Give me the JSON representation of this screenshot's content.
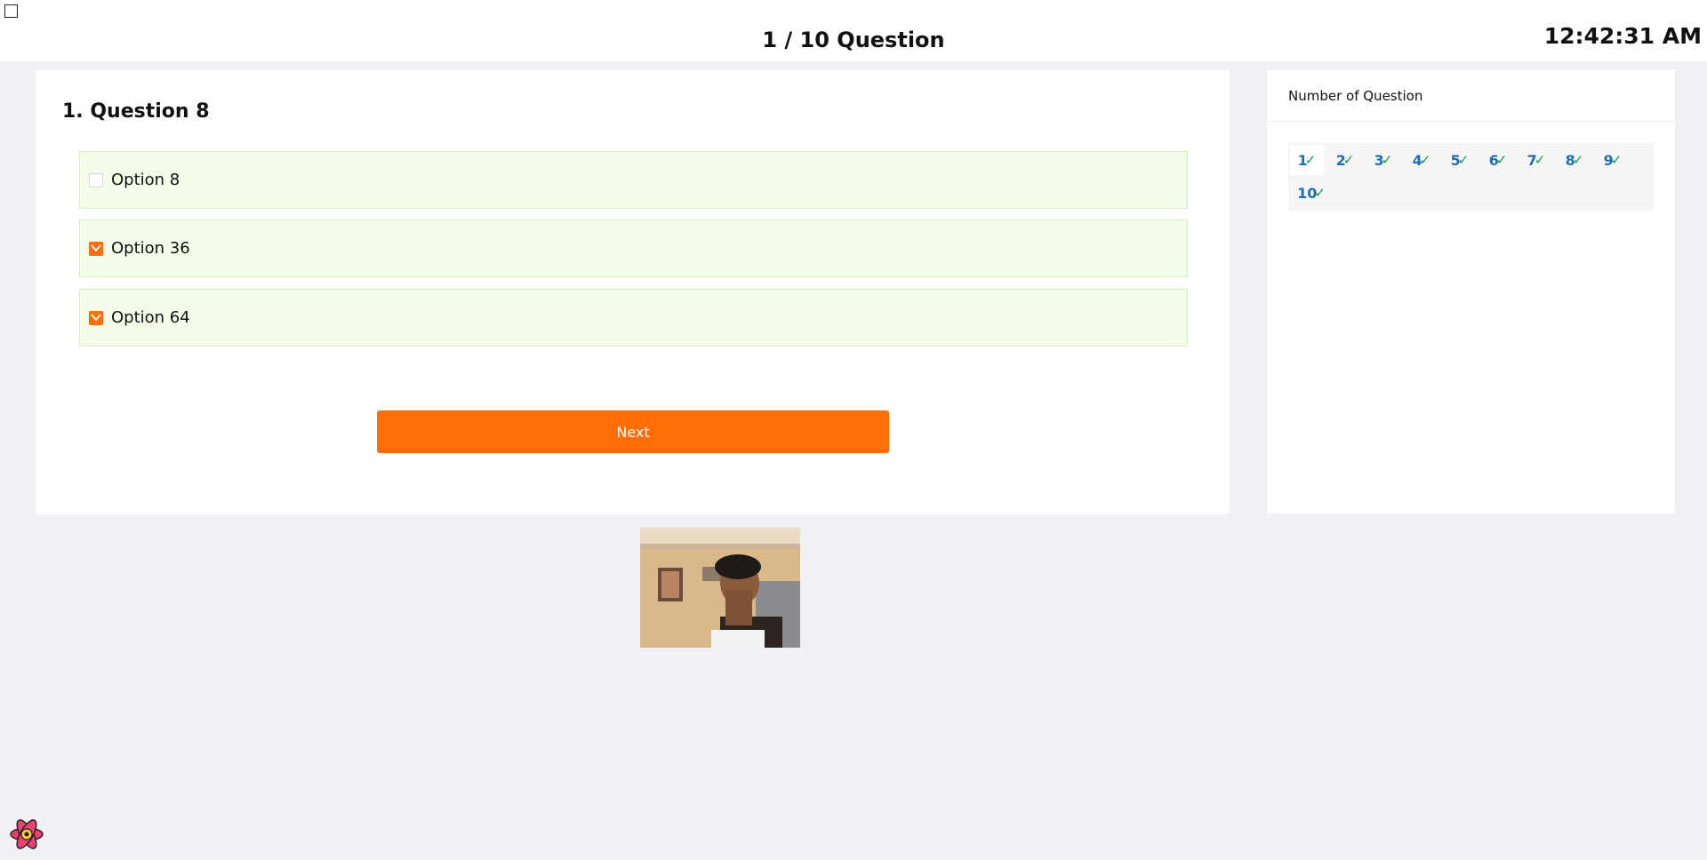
{
  "header": {
    "title": "1 / 10 Question",
    "clock": "12:42:31 AM"
  },
  "question": {
    "title": "1. Question 8",
    "options": [
      {
        "label": "Option 8",
        "checked": false
      },
      {
        "label": "Option 36",
        "checked": true
      },
      {
        "label": "Option 64",
        "checked": true
      }
    ],
    "next_label": "Next"
  },
  "sidebar": {
    "title": "Number of Question",
    "numbers": [
      "1",
      "2",
      "3",
      "4",
      "5",
      "6",
      "7",
      "8",
      "9",
      "10"
    ],
    "answered_mark": "✓"
  },
  "colors": {
    "accent": "#ff6e05",
    "option_bg": "#f4fde9",
    "number": "#1f6fb5",
    "tick": "#1a9a4a"
  }
}
